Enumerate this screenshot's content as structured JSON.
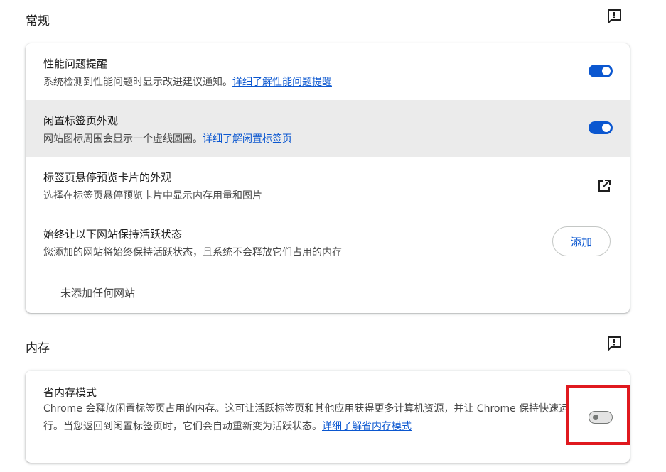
{
  "general_section": {
    "title": "常规",
    "feedback_icon": "feedback-icon"
  },
  "performance_alerts": {
    "title": "性能问题提醒",
    "description": "系统检测到性能问题时显示改进建议通知。",
    "link": "详细了解性能问题提醒",
    "toggle_state": "on"
  },
  "inactive_tabs": {
    "title": "闲置标签页外观",
    "description": "网站图标周围会显示一个虚线圆圈。",
    "link": "详细了解闲置标签页",
    "toggle_state": "on"
  },
  "hover_card": {
    "title": "标签页悬停预览卡片的外观",
    "description": "选择在标签页悬停预览卡片中显示内存用量和图片",
    "icon": "open-external-icon"
  },
  "always_active": {
    "title": "始终让以下网站保持活跃状态",
    "description": "您添加的网站将始终保持活跃状态，且系统不会释放它们占用的内存",
    "add_label": "添加",
    "empty_text": "未添加任何网站"
  },
  "memory_section": {
    "title": "内存",
    "feedback_icon": "feedback-icon"
  },
  "memory_saver": {
    "title": "省内存模式",
    "description": "Chrome 会释放闲置标签页占用的内存。这可让活跃标签页和其他应用获得更多计算机资源，并让 Chrome 保持快速运行。当您返回到闲置标签页时，它们会自动重新变为活跃状态。",
    "link": "详细了解省内存模式",
    "toggle_state": "off"
  },
  "colors": {
    "accent": "#0b57d0",
    "highlight": "#e0191f",
    "hover_row": "#ebebeb"
  }
}
